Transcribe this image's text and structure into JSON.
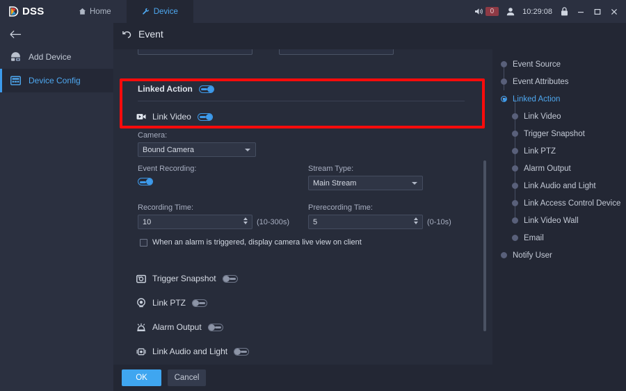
{
  "titlebar": {
    "logo_text": "DSS",
    "tabs": [
      {
        "label": "Home",
        "icon": "home-icon",
        "active": false
      },
      {
        "label": "Device",
        "icon": "wrench-icon",
        "active": true
      }
    ],
    "volume_icon": "speaker-icon",
    "alarm_count": "0",
    "user_icon": "user-icon",
    "clock": "10:29:08",
    "lock_icon": "lock-icon",
    "minimize_icon": "minimize-icon",
    "maximize_icon": "maximize-icon",
    "close_icon": "close-icon"
  },
  "sidebar": {
    "back_icon": "arrow-left-icon",
    "items": [
      {
        "label": "Add Device",
        "icon": "add-device-icon",
        "active": false
      },
      {
        "label": "Device Config",
        "icon": "device-config-icon",
        "active": true
      }
    ]
  },
  "page": {
    "back_icon": "undo-arrow-icon",
    "title": "Event"
  },
  "form": {
    "linked_action_label": "Linked Action",
    "linked_action_state": "on",
    "link_video_label": "Link Video",
    "link_video_icon": "video-camera-icon",
    "link_video_state": "on",
    "camera_label": "Camera:",
    "camera_value": "Bound Camera",
    "event_recording_label": "Event Recording:",
    "event_recording_state": "on",
    "stream_type_label": "Stream Type:",
    "stream_type_value": "Main Stream",
    "recording_time_label": "Recording Time:",
    "recording_time_value": "10",
    "recording_time_hint": "(10-300s)",
    "prerecording_time_label": "Prerecording Time:",
    "prerecording_time_value": "5",
    "prerecording_time_hint": "(0-10s)",
    "live_view_checkbox_label": "When an alarm is triggered, display camera live view on client",
    "live_view_checked": false,
    "actions": [
      {
        "label": "Trigger Snapshot",
        "icon": "snapshot-icon",
        "state": "off"
      },
      {
        "label": "Link PTZ",
        "icon": "ptz-dome-icon",
        "state": "off"
      },
      {
        "label": "Alarm Output",
        "icon": "alarm-siren-icon",
        "state": "off"
      },
      {
        "label": "Link Audio and Light",
        "icon": "audio-light-icon",
        "state": "off"
      }
    ]
  },
  "tree": {
    "nodes": [
      {
        "label": "Event Source",
        "level": 0,
        "active": false
      },
      {
        "label": "Event Attributes",
        "level": 0,
        "active": false
      },
      {
        "label": "Linked Action",
        "level": 0,
        "active": true
      },
      {
        "label": "Link Video",
        "level": 1,
        "active": false
      },
      {
        "label": "Trigger Snapshot",
        "level": 1,
        "active": false
      },
      {
        "label": "Link PTZ",
        "level": 1,
        "active": false
      },
      {
        "label": "Alarm Output",
        "level": 1,
        "active": false
      },
      {
        "label": "Link Audio and Light",
        "level": 1,
        "active": false
      },
      {
        "label": "Link Access Control Device",
        "level": 1,
        "active": false
      },
      {
        "label": "Link Video Wall",
        "level": 1,
        "active": false
      },
      {
        "label": "Email",
        "level": 1,
        "active": false
      },
      {
        "label": "Notify User",
        "level": 0,
        "active": false
      }
    ]
  },
  "footer": {
    "ok_label": "OK",
    "cancel_label": "Cancel"
  },
  "colors": {
    "accent": "#3d9bec",
    "highlight_box": "#fb0b0b",
    "badge": "#8e3a45",
    "panel_bg": "#272c3a",
    "frame_bg": "#232734",
    "chrome_bg": "#2b3040"
  }
}
